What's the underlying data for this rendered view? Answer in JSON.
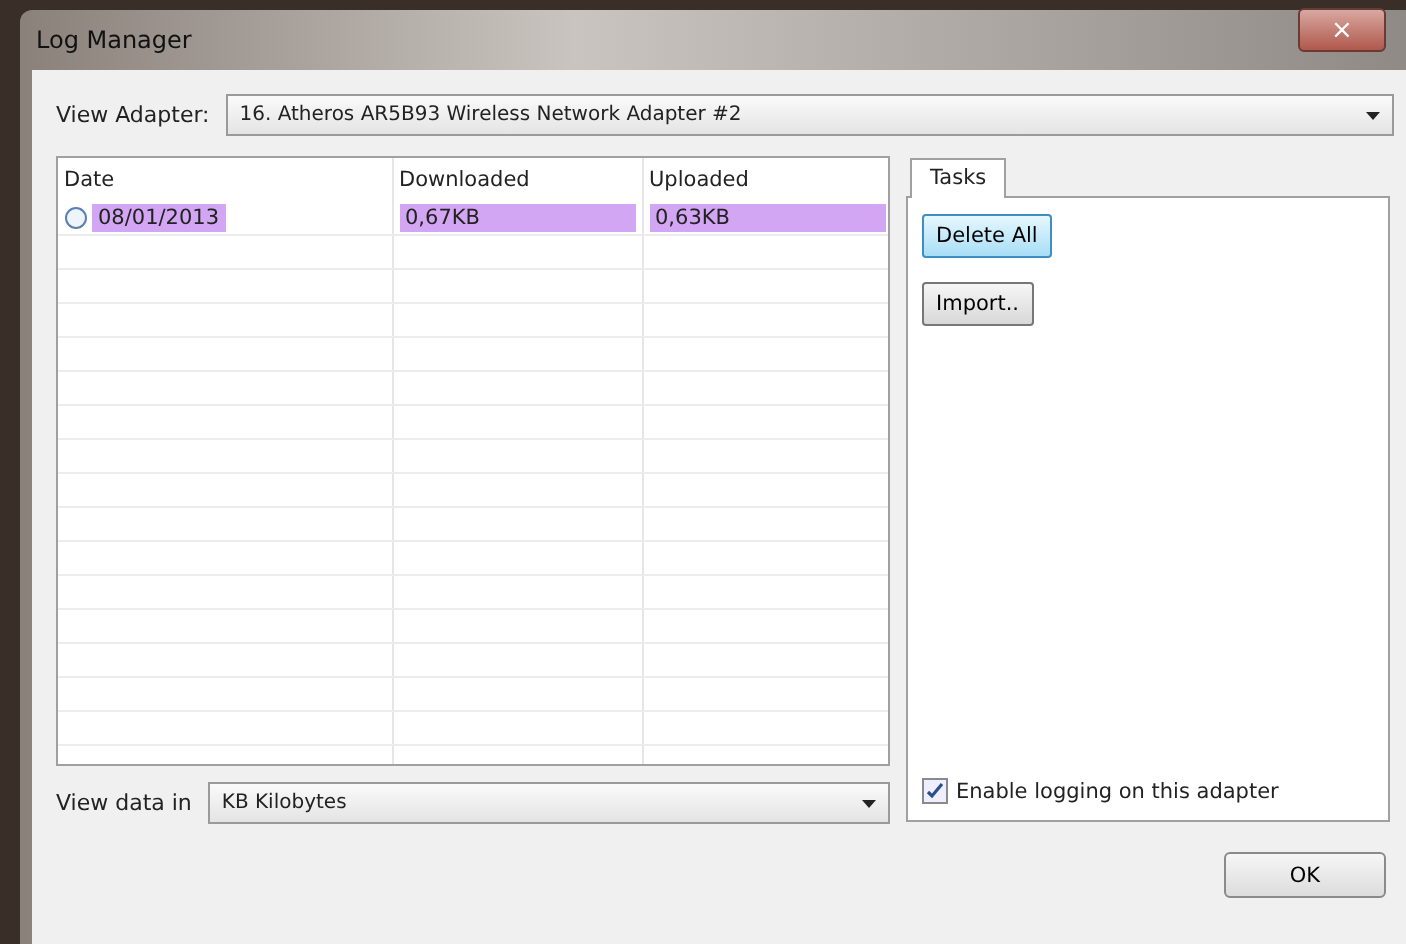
{
  "window": {
    "title": "Log Manager",
    "close": "×"
  },
  "adapter": {
    "label": "View Adapter:",
    "value": "16. Atheros AR5B93 Wireless Network Adapter #2"
  },
  "table": {
    "columns": [
      "Date",
      "Downloaded",
      "Uploaded"
    ],
    "rows": [
      {
        "cells": [
          "08/01/2013",
          "0,67KB",
          "0,63KB"
        ],
        "selected": true
      }
    ]
  },
  "tabs": [
    {
      "label": "Tasks",
      "selected": true
    }
  ],
  "buttons": [
    {
      "label": "Delete All",
      "focused": true
    },
    {
      "label": "Import..",
      "focused": false
    }
  ],
  "units": {
    "label": "View data in",
    "value": "KB Kilobytes"
  },
  "logging": {
    "label": "Enable logging on this adapter",
    "checked": true
  },
  "ok": "OK"
}
